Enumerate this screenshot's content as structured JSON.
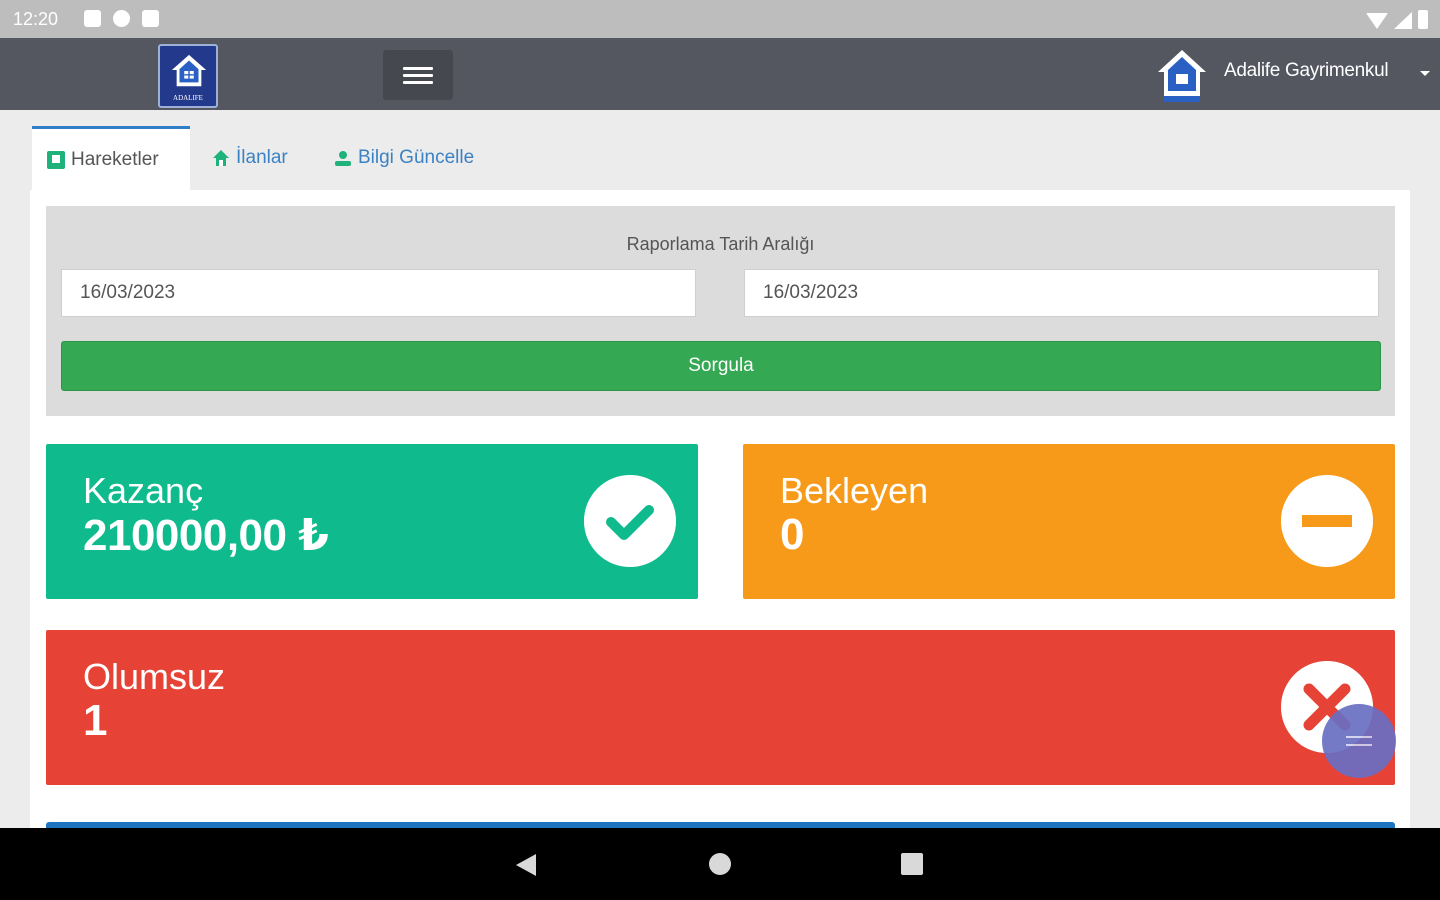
{
  "status_bar": {
    "time": "12:20"
  },
  "header": {
    "logo_text": "ADALIFE",
    "user_name": "Adalife Gayrimenkul"
  },
  "tabs": [
    {
      "label": "Hareketler",
      "icon": "register-icon",
      "active": true
    },
    {
      "label": "İlanlar",
      "icon": "home-icon",
      "active": false
    },
    {
      "label": "Bilgi Güncelle",
      "icon": "user-icon",
      "active": false
    }
  ],
  "filter": {
    "title": "Raporlama Tarih Aralığı",
    "start_date": "16/03/2023",
    "end_date": "16/03/2023",
    "button_label": "Sorgula"
  },
  "stats": {
    "kazanc": {
      "label": "Kazanç",
      "value": "210000,00 ₺",
      "icon": "check-circle-icon",
      "color": "#0fba8c"
    },
    "bekleyen": {
      "label": "Bekleyen",
      "value": "0",
      "icon": "minus-circle-icon",
      "color": "#f79a1a"
    },
    "olumsuz": {
      "label": "Olumsuz",
      "value": "1",
      "icon": "times-circle-icon",
      "color": "#e64336"
    }
  },
  "colors": {
    "navbar": "#545760",
    "tab_link": "#3b82c4",
    "button": "#35a853",
    "fab": "#6a6fc3"
  }
}
